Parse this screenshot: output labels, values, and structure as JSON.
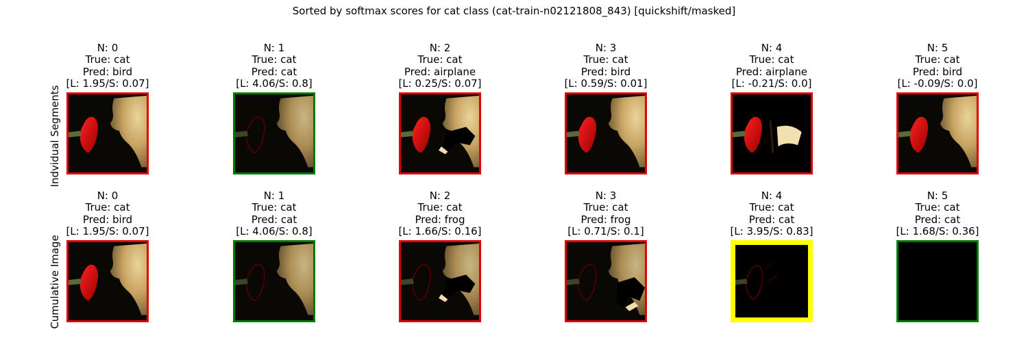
{
  "suptitle": "Sorted by softmax scores for cat class (cat-train-n02121808_843) [quickshift/masked]",
  "row_labels": [
    "Indvidual Segments",
    "Cumulative Image"
  ],
  "frame_colors": {
    "red": "#e00000",
    "green": "#007a00",
    "yellow": "#ffff00"
  },
  "rows": [
    {
      "panels": [
        {
          "n": "N: 0",
          "true_label": "True: cat",
          "pred": "Pred: bird",
          "scores": "[L: 1.95/S: 0.07]",
          "frame": "red"
        },
        {
          "n": "N: 1",
          "true_label": "True: cat",
          "pred": "Pred: cat",
          "scores": "[L: 4.06/S: 0.8]",
          "frame": "green"
        },
        {
          "n": "N: 2",
          "true_label": "True: cat",
          "pred": "Pred: airplane",
          "scores": "[L: 0.25/S: 0.07]",
          "frame": "red"
        },
        {
          "n": "N: 3",
          "true_label": "True: cat",
          "pred": "Pred: bird",
          "scores": "[L: 0.59/S: 0.01]",
          "frame": "red"
        },
        {
          "n": "N: 4",
          "true_label": "True: cat",
          "pred": "Pred: airplane",
          "scores": "[L: -0.21/S: 0.0]",
          "frame": "red"
        },
        {
          "n": "N: 5",
          "true_label": "True: cat",
          "pred": "Pred: bird",
          "scores": "[L: -0.09/S: 0.0]",
          "frame": "red"
        }
      ]
    },
    {
      "panels": [
        {
          "n": "N: 0",
          "true_label": "True: cat",
          "pred": "Pred: bird",
          "scores": "[L: 1.95/S: 0.07]",
          "frame": "red"
        },
        {
          "n": "N: 1",
          "true_label": "True: cat",
          "pred": "Pred: cat",
          "scores": "[L: 4.06/S: 0.8]",
          "frame": "green"
        },
        {
          "n": "N: 2",
          "true_label": "True: cat",
          "pred": "Pred: frog",
          "scores": "[L: 1.66/S: 0.16]",
          "frame": "red"
        },
        {
          "n": "N: 3",
          "true_label": "True: cat",
          "pred": "Pred: frog",
          "scores": "[L: 0.71/S: 0.1]",
          "frame": "red"
        },
        {
          "n": "N: 4",
          "true_label": "True: cat",
          "pred": "Pred: cat",
          "scores": "[L: 3.95/S: 0.83]",
          "frame": "yellow"
        },
        {
          "n": "N: 5",
          "true_label": "True: cat",
          "pred": "Pred: cat",
          "scores": "[L: 1.68/S: 0.36]",
          "frame": "green"
        }
      ]
    }
  ]
}
